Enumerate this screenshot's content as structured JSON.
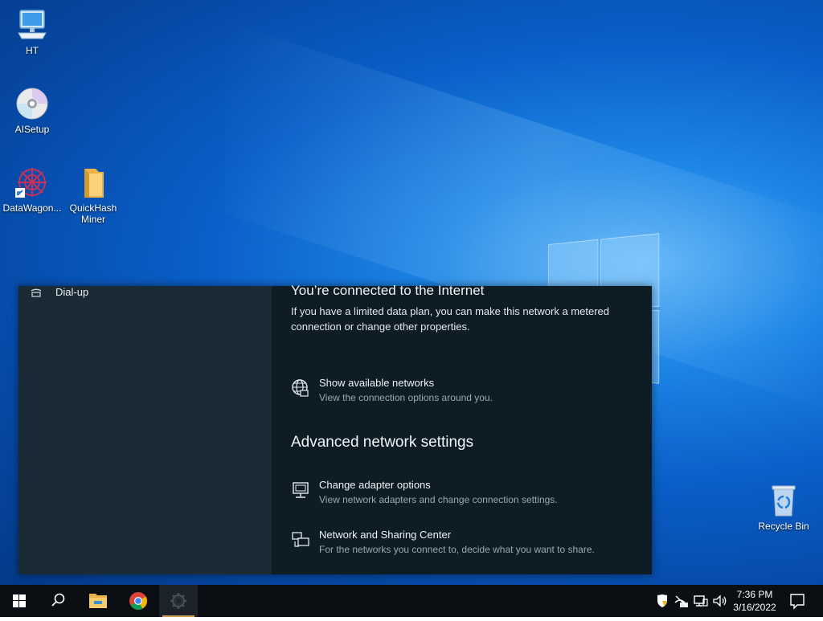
{
  "desktop": {
    "icons": [
      {
        "label": "HT",
        "icon": "computer-icon"
      },
      {
        "label": "AISetup",
        "icon": "cd-disc-icon"
      },
      {
        "label": "DataWagon...",
        "icon": "datawagon-shortcut-icon"
      },
      {
        "label": "QuickHash Miner",
        "icon": "folder-icon"
      },
      {
        "label": "Recycle Bin",
        "icon": "recycle-bin-icon"
      }
    ]
  },
  "settings": {
    "sidebar": {
      "dialup_label": "Dial-up",
      "dialup_icon": "dialup-icon"
    },
    "status": {
      "title": "You’re connected to the Internet",
      "description": "If you have a limited data plan, you can make this network a metered connection or change other properties."
    },
    "show_networks": {
      "title": "Show available networks",
      "subtitle": "View the connection options around you.",
      "icon": "globe-icon"
    },
    "advanced": {
      "heading": "Advanced network settings",
      "options": [
        {
          "title": "Change adapter options",
          "subtitle": "View network adapters and change connection settings.",
          "icon": "adapter-icon"
        },
        {
          "title": "Network and Sharing Center",
          "subtitle": "For the networks you connect to, decide what you want to share.",
          "icon": "sharing-center-icon"
        }
      ]
    }
  },
  "taskbar": {
    "apps": [
      "start-icon",
      "search-icon",
      "file-explorer-icon",
      "chrome-icon",
      "settings-gear-icon"
    ],
    "tray": [
      "security-shield-icon",
      "network-offline-icon",
      "network-icon",
      "volume-icon"
    ],
    "time": "7:36 PM",
    "date": "3/16/2022",
    "notification_icon": "notification-icon",
    "accent": "#c9a15d"
  }
}
